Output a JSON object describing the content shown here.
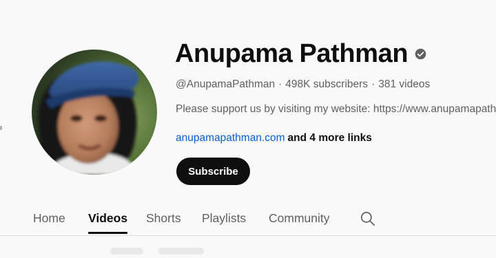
{
  "channel": {
    "name": "Anupama Pathman",
    "verified_icon": "verified-check-icon",
    "handle": "@AnupamaPathman",
    "separator": "·",
    "subscribers": "498K subscribers",
    "videos": "381 videos",
    "description": "Please support us by visiting my website: https://www.anupamapathman.com",
    "link_text": "anupamapathman.com",
    "more_links": "and 4 more links",
    "avatar_icon": "channel-avatar"
  },
  "actions": {
    "subscribe_label": "Subscribe"
  },
  "tabs": [
    {
      "label": "Home",
      "active": false
    },
    {
      "label": "Videos",
      "active": true
    },
    {
      "label": "Shorts",
      "active": false
    },
    {
      "label": "Playlists",
      "active": false
    },
    {
      "label": "Community",
      "active": false
    }
  ],
  "tabs_search_icon": "search-icon",
  "colors": {
    "text_primary": "#0f0f0f",
    "text_secondary": "#606060",
    "link": "#065fd4",
    "button_bg": "#0f0f0f",
    "button_text": "#ffffff",
    "page_bg": "#f9f9f9"
  }
}
